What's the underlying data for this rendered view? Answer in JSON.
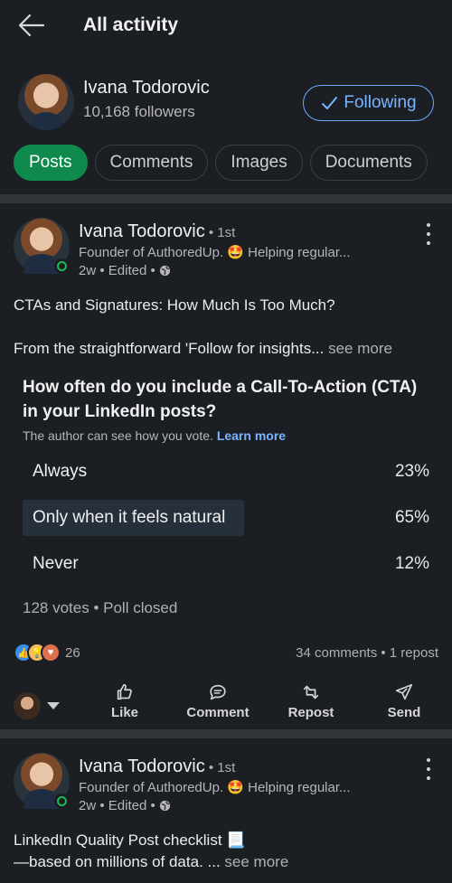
{
  "header": {
    "title": "All activity",
    "back_icon": "arrow-left-icon"
  },
  "profile": {
    "name": "Ivana Todorovic",
    "followers": "10,168 followers",
    "follow_label": "Following"
  },
  "tabs": [
    {
      "label": "Posts",
      "active": true
    },
    {
      "label": "Comments",
      "active": false
    },
    {
      "label": "Images",
      "active": false
    },
    {
      "label": "Documents",
      "active": false
    }
  ],
  "posts": [
    {
      "author": "Ivana Todorovic",
      "degree": " • 1st",
      "headline": "Founder of AuthoredUp. 🤩 Helping regular...",
      "meta": "2w • Edited •",
      "line1": "CTAs and Signatures: How Much Is Too Much?",
      "line2": "From the straightforward 'Follow for insights...",
      "see_more": " see more",
      "poll": {
        "question": "How often do you include a Call-To-Action (CTA) in your LinkedIn posts?",
        "note": "The author can see how you vote.",
        "learn_more": "Learn more",
        "options": [
          {
            "label": "Always",
            "percent": "23%",
            "highlighted": false
          },
          {
            "label": "Only when it feels natural",
            "percent": "65%",
            "highlighted": true
          },
          {
            "label": "Never",
            "percent": "12%",
            "highlighted": false
          }
        ],
        "summary": "128 votes • Poll closed"
      },
      "reaction_count": "26",
      "social_counts": "34 comments • 1 repost"
    },
    {
      "author": "Ivana Todorovic",
      "degree": " • 1st",
      "headline": "Founder of AuthoredUp. 🤩 Helping regular...",
      "meta": "2w • Edited •",
      "line1": "LinkedIn Quality Post checklist 📃",
      "line2": "—based on millions of data. ...",
      "see_more": " see more"
    }
  ],
  "actions": {
    "like": "Like",
    "comment": "Comment",
    "repost": "Repost",
    "send": "Send"
  },
  "colors": {
    "background": "#1b1f23",
    "accent_green": "#0f8a4c",
    "link_blue": "#7ab4ff"
  }
}
